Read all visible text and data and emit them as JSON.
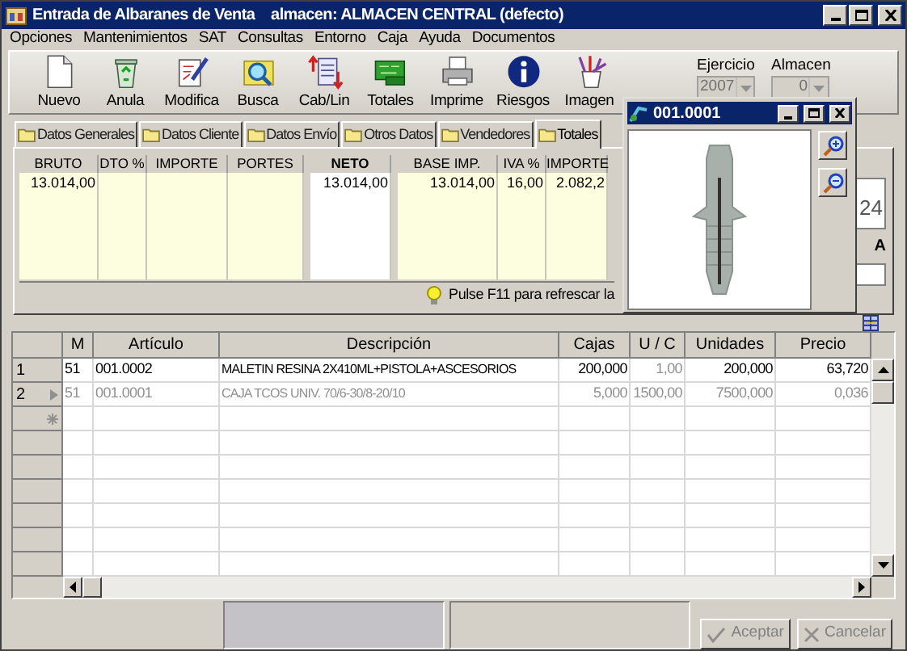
{
  "window": {
    "title": "Entrada de Albaranes de Venta    almacen: ALMACEN CENTRAL (defecto)"
  },
  "menu": [
    "Opciones",
    "Mantenimientos",
    "SAT",
    "Consultas",
    "Entorno",
    "Caja",
    "Ayuda",
    "Documentos"
  ],
  "toolbar": [
    {
      "label": "Nuevo"
    },
    {
      "label": "Anula"
    },
    {
      "label": "Modifica"
    },
    {
      "label": "Busca"
    },
    {
      "label": "Cab/Lin"
    },
    {
      "label": "Totales"
    },
    {
      "label": "Imprime"
    },
    {
      "label": "Riesgos"
    },
    {
      "label": "Imagen"
    }
  ],
  "selectors": [
    {
      "label": "Ejercicio",
      "value": "2007",
      "disabled": true
    },
    {
      "label": "Almacen",
      "value": "0",
      "disabled": true
    }
  ],
  "tabs": [
    {
      "label": "Datos Generales",
      "selected": false
    },
    {
      "label": "Datos Cliente",
      "selected": false
    },
    {
      "label": "Datos Envío",
      "selected": false
    },
    {
      "label": "Otros Datos",
      "selected": false
    },
    {
      "label": "Vendedores",
      "selected": false
    },
    {
      "label": "Totales",
      "selected": true
    }
  ],
  "totals": {
    "groups": [
      {
        "kind": "plain",
        "columns": [
          {
            "label": "BRUTO",
            "value": "13.014,00"
          },
          {
            "label": "DTO %"
          },
          {
            "label": "IMPORTE"
          },
          {
            "label": "PORTES"
          }
        ]
      },
      {
        "kind": "emphasis",
        "columns": [
          {
            "label": "NETO",
            "value": "13.014,00"
          }
        ]
      },
      {
        "kind": "plain",
        "columns": [
          {
            "label": "BASE IMP.",
            "value": "13.014,00"
          },
          {
            "label": "IVA %",
            "value": "16,00"
          },
          {
            "label": "IMPORTE",
            "value": "2.082,2"
          }
        ]
      }
    ],
    "hint": "Pulse F11 para refrescar la",
    "side_value": "24",
    "side_label": "A"
  },
  "image_window": {
    "title": "001.0001"
  },
  "grid": {
    "columns": [
      {
        "label": "M",
        "readonly": false
      },
      {
        "label": "Artículo",
        "readonly": false
      },
      {
        "label": "Descripción",
        "readonly": false
      },
      {
        "label": "Cajas",
        "readonly": false
      },
      {
        "label": "U / C",
        "readonly": true
      },
      {
        "label": "Unidades",
        "readonly": false
      },
      {
        "label": "Precio",
        "readonly": false
      }
    ],
    "rows": [
      {
        "kind": "item",
        "number": "1",
        "current": false,
        "dimmed": false,
        "cells": [
          "51",
          "001.0002",
          "MALETIN RESINA 2X410ML+PISTOLA+ASCESORIOS",
          "200,000",
          "1,00",
          "200,000",
          "63,720"
        ]
      },
      {
        "kind": "item",
        "number": "2",
        "current": true,
        "dimmed": true,
        "cells": [
          "51",
          "001.0001",
          "CAJA TCOS UNIV. 70/6-30/8-20/10",
          "5,000",
          "1500,00",
          "7500,000",
          "0,036"
        ]
      },
      {
        "kind": "new"
      }
    ]
  },
  "buttons": [
    {
      "label": "Aceptar",
      "disabled": true
    },
    {
      "label": "Cancelar",
      "disabled": true
    }
  ]
}
